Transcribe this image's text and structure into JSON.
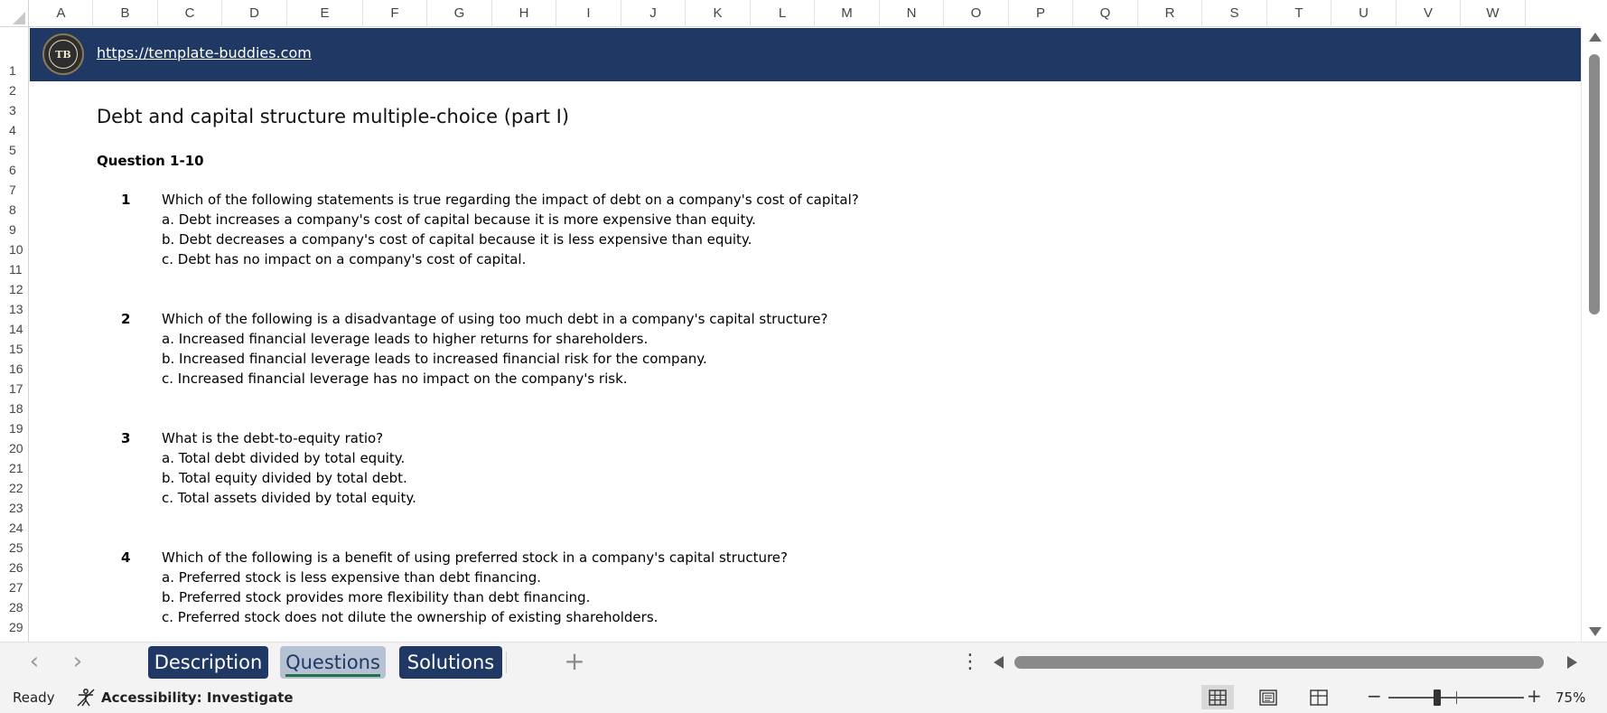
{
  "columns": [
    "A",
    "B",
    "C",
    "D",
    "E",
    "F",
    "G",
    "H",
    "I",
    "J",
    "K",
    "L",
    "M",
    "N",
    "O",
    "P",
    "Q",
    "R",
    "S",
    "T",
    "U",
    "V",
    "W"
  ],
  "rows": [
    "1",
    "2",
    "3",
    "4",
    "5",
    "6",
    "7",
    "8",
    "9",
    "10",
    "11",
    "12",
    "13",
    "14",
    "15",
    "16",
    "17",
    "18",
    "19",
    "20",
    "21",
    "22",
    "23",
    "24",
    "25",
    "26",
    "27",
    "28",
    "29"
  ],
  "banner": {
    "logo_text": "TB",
    "link": "https://template-buddies.com"
  },
  "content": {
    "title": "Debt and capital structure multiple-choice (part I)",
    "section": "Question 1-10",
    "questions": [
      {
        "number": "1",
        "text": "Which of the following statements is true regarding the impact of debt on a company's cost of capital?",
        "options": [
          "a. Debt increases a company's cost of capital because it is more expensive than equity.",
          "b. Debt decreases a company's cost of capital because it is less expensive than equity.",
          "c. Debt has no impact on a company's cost of capital."
        ]
      },
      {
        "number": "2",
        "text": "Which of the following is a disadvantage of using too much debt in a company's capital structure?",
        "options": [
          "a. Increased financial leverage leads to higher returns for shareholders.",
          "b. Increased financial leverage leads to increased financial risk for the company.",
          "c. Increased financial leverage has no impact on the company's risk."
        ]
      },
      {
        "number": "3",
        "text": "What is the debt-to-equity ratio?",
        "options": [
          "a. Total debt divided by total equity.",
          "b. Total equity divided by total debt.",
          "c. Total assets divided by total equity."
        ]
      },
      {
        "number": "4",
        "text": "Which of the following is a benefit of using preferred stock in a company's capital structure?",
        "options": [
          "a. Preferred stock is less expensive than debt financing.",
          "b. Preferred stock provides more flexibility than debt financing.",
          "c. Preferred stock does not dilute the ownership of existing shareholders."
        ]
      }
    ]
  },
  "tabs": [
    {
      "label": "Description",
      "active": false
    },
    {
      "label": "Questions",
      "active": true
    },
    {
      "label": "Solutions",
      "active": false
    }
  ],
  "tab_controls": {
    "prev": "‹",
    "next": "›",
    "add": "+",
    "more": "⋮"
  },
  "status": {
    "ready": "Ready",
    "accessibility": "Accessibility: Investigate",
    "zoom_minus": "−",
    "zoom_plus": "+",
    "zoom": "75%"
  },
  "colors": {
    "banner": "#1f3864",
    "active_tab_underline": "#217346",
    "active_tab_bg": "#b6c2d3"
  }
}
